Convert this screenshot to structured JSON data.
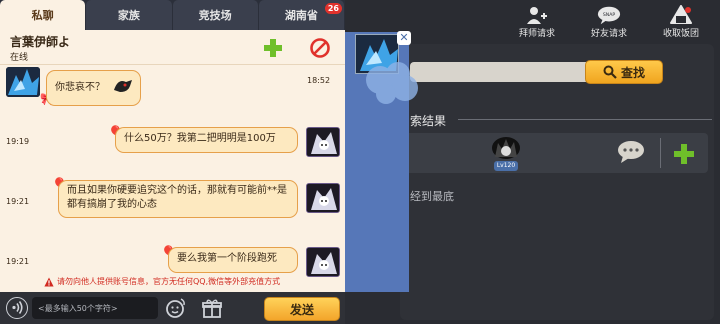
{
  "tabs": [
    {
      "label": "私聊",
      "active": true
    },
    {
      "label": "家族",
      "active": false
    },
    {
      "label": "竞技场",
      "active": false
    },
    {
      "label": "湖南省",
      "active": false,
      "badge": "26"
    }
  ],
  "contact": {
    "name": "言葉伊師よ",
    "status": "在线"
  },
  "messages": [
    {
      "side": "left",
      "time": "18:52",
      "text": "你悲哀不？"
    },
    {
      "side": "right",
      "time": "19:19",
      "text": "什么50万？我第二把明明是100万"
    },
    {
      "side": "right",
      "time": "19:21",
      "text": "而且如果你硬要追究这个的话，那就有可能前**是都有搞崩了我的心态"
    },
    {
      "side": "right",
      "time": "19:21",
      "text": "要么我第一个阶段跑死"
    }
  ],
  "warning": "请勿向他人提供账号信息，官方无任何QQ,微信等外部充值方式",
  "input": {
    "placeholder": "<最多输入50个字符>"
  },
  "send_label": "发送",
  "top_actions": [
    {
      "label": "拜师请求",
      "icon": "add-mentor-icon"
    },
    {
      "label": "好友请求",
      "icon": "friend-request-icon"
    },
    {
      "label": "收取饭团",
      "icon": "rice-ball-icon"
    }
  ],
  "search": {
    "button_label": "查找",
    "value": ""
  },
  "results": {
    "title": "索结果",
    "level": "Lv120",
    "end_note": "经到最底"
  },
  "colors": {
    "accent": "#f3a52a",
    "chat_bg": "#fbf1e3",
    "warning": "#d12a20",
    "dark_bg": "#2a2c32",
    "blue_strip": "#5677b8"
  }
}
